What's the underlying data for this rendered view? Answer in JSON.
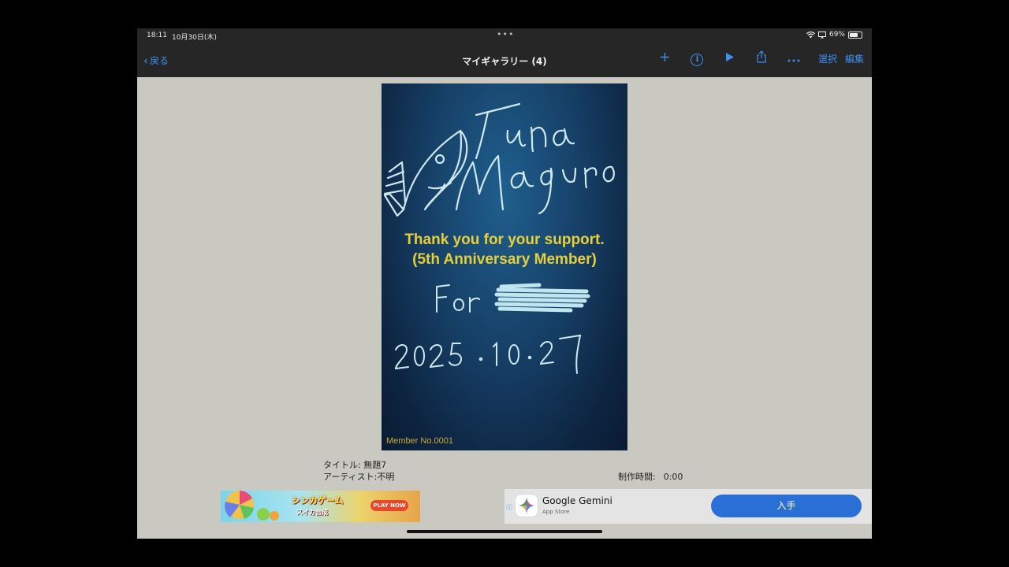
{
  "status": {
    "time": "18:11",
    "date": "10月30日(木)",
    "dots": "•••",
    "battery_text": "69%"
  },
  "nav": {
    "back_label": "戻る",
    "title": "マイギャラリー (4)",
    "select_label": "選択",
    "edit_label": "編集",
    "icons": [
      "plus-icon",
      "info-icon",
      "play-icon",
      "share-icon",
      "more-icon"
    ]
  },
  "artwork": {
    "handwritten_lines": [
      "Tuna",
      "Maguro",
      "For",
      "2025.10.27"
    ],
    "thanks_line1": "Thank you for your support.",
    "thanks_line2": "(5th Anniversary Member)",
    "member_no": "Member No.0001"
  },
  "meta": {
    "title": "タイトル: 無題7",
    "artist": "アーティスト:不明",
    "time_label": "制作時間:",
    "time_value": "0:00"
  },
  "ads": {
    "left_banner": {
      "title": "シンカゲーム",
      "subtitle": "スイカ合成",
      "button": "PLAY NOW"
    },
    "right_banner": {
      "app_name": "Google Gemini",
      "store": "App Store",
      "button": "入手"
    }
  },
  "colors": {
    "accent": "#3d8ff0",
    "bar_bg": "#262626",
    "content_bg": "#c9c9c1",
    "art_text": "#e7cf3a",
    "get_button": "#2a6fd6"
  }
}
